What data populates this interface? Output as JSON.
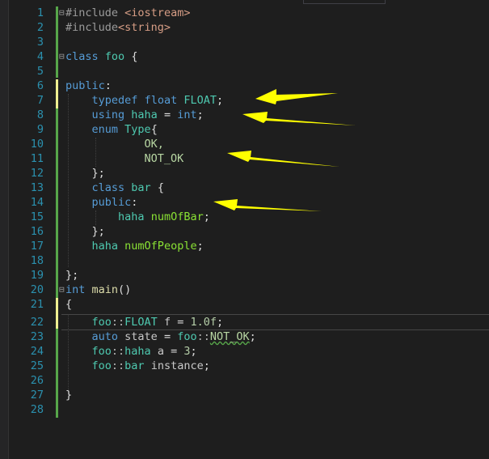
{
  "editor": {
    "lines": [
      {
        "n": "1"
      },
      {
        "n": "2"
      },
      {
        "n": "3"
      },
      {
        "n": "4"
      },
      {
        "n": "5"
      },
      {
        "n": "6"
      },
      {
        "n": "7"
      },
      {
        "n": "8"
      },
      {
        "n": "9"
      },
      {
        "n": "10"
      },
      {
        "n": "11"
      },
      {
        "n": "12"
      },
      {
        "n": "13"
      },
      {
        "n": "14"
      },
      {
        "n": "15"
      },
      {
        "n": "16"
      },
      {
        "n": "17"
      },
      {
        "n": "18"
      },
      {
        "n": "19"
      },
      {
        "n": "20"
      },
      {
        "n": "21"
      },
      {
        "n": "22"
      },
      {
        "n": "23"
      },
      {
        "n": "24"
      },
      {
        "n": "25"
      },
      {
        "n": "26"
      },
      {
        "n": "27"
      },
      {
        "n": "28"
      }
    ],
    "tokens": {
      "inc1": "#include",
      "iostream": "<iostream>",
      "inc2": "#include",
      "string": "<string>",
      "kw_class": "class",
      "foo": "foo",
      "brace_open": "{",
      "kw_public": "public",
      "colon": ":",
      "kw_typedef": "typedef",
      "kw_float": "float",
      "FLOAT": "FLOAT",
      "semi": ";",
      "kw_using": "using",
      "haha": "haha",
      "eq": "=",
      "kw_int": "int",
      "kw_enum": "enum",
      "Type": "Type",
      "OK": "OK,",
      "NOT_OK": "NOT_OK",
      "close_semi": "};",
      "bar": "bar",
      "numOfBar": "numOfBar",
      "numOfPeople": "numOfPeople",
      "close": "}",
      "main": "main",
      "parens": "()",
      "scope": "::",
      "f": "f",
      "val": "1.0f",
      "kw_auto": "auto",
      "state": "state",
      "NOT_OK2": "NOT_OK",
      "a": "a",
      "three": "3",
      "instance": "instance"
    }
  },
  "colors": {
    "background": "#1e1e1e",
    "line_number": "#2b91af",
    "keyword": "#569cd6",
    "type": "#4ec9b0",
    "arrow": "#ffff00",
    "gutter_saved": "#57a64a",
    "gutter_unsaved": "#efef91"
  }
}
